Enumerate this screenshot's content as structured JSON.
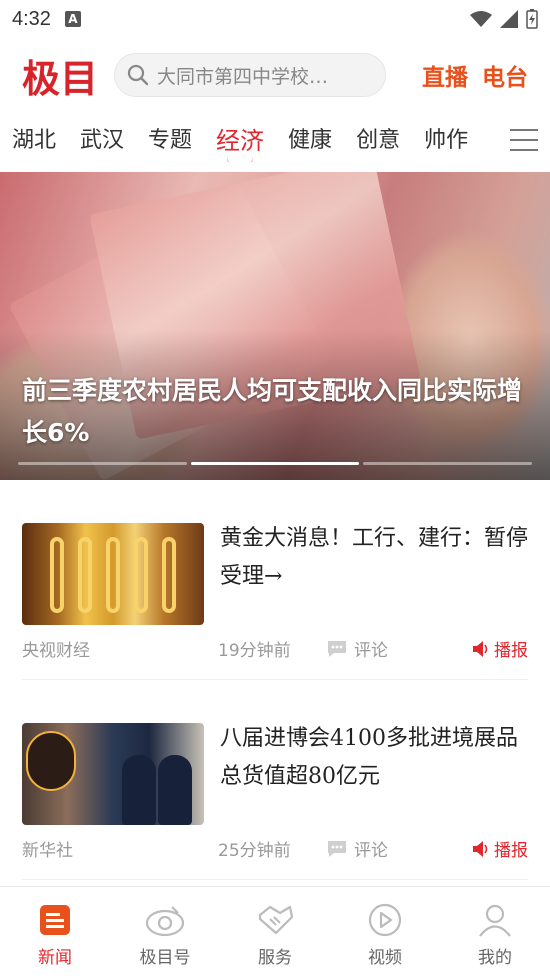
{
  "status_bar": {
    "time": "4:32",
    "notification_icon": "A"
  },
  "header": {
    "logo": "极目",
    "search_placeholder": "大同市第四中学校…",
    "links": [
      "直播",
      "电台"
    ]
  },
  "channel_tabs": {
    "items": [
      "湖北",
      "武汉",
      "专题",
      "经济",
      "健康",
      "创意",
      "帅作"
    ],
    "active": "经济"
  },
  "hero": {
    "title": "前三季度农村居民人均可支配收入同比实际增长6%",
    "page_count": 3,
    "active_page": 2
  },
  "news": [
    {
      "title": "黄金大消息！工行、建行：暂停受理→",
      "source": "央视财经",
      "time": "19分钟前",
      "comment_label": "评论",
      "play_label": "播报",
      "thumb": "gold-bracelets"
    },
    {
      "title": "八届进博会4100多批进境展品总货值超80亿元",
      "source": "新华社",
      "time": "25分钟前",
      "comment_label": "评论",
      "play_label": "播报",
      "thumb": "customs-officers"
    }
  ],
  "bottom_nav": {
    "items": [
      {
        "label": "新闻",
        "icon": "news-icon",
        "active": true
      },
      {
        "label": "极目号",
        "icon": "jimu-account-icon",
        "active": false
      },
      {
        "label": "服务",
        "icon": "handshake-icon",
        "active": false
      },
      {
        "label": "视频",
        "icon": "play-circle-icon",
        "active": false
      },
      {
        "label": "我的",
        "icon": "user-icon",
        "active": false
      }
    ]
  },
  "colors": {
    "brand_red": "#e1262d",
    "accent_orange": "#e8501c"
  }
}
